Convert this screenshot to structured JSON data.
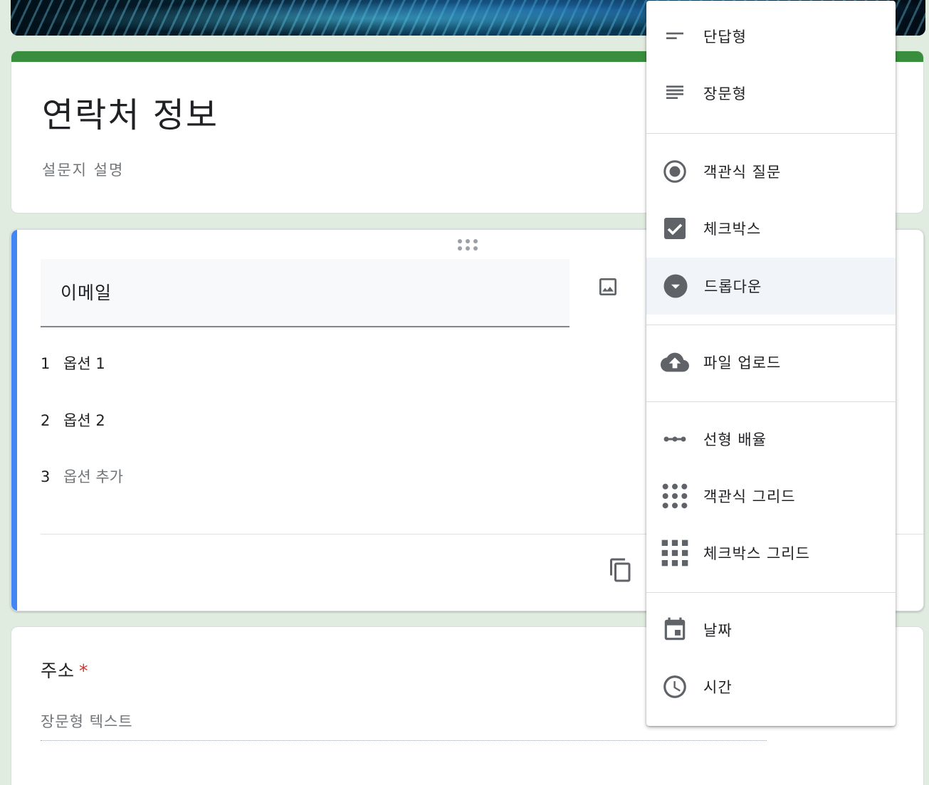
{
  "form": {
    "title": "연락처 정보",
    "description": "설문지 설명"
  },
  "question": {
    "title": "이메일",
    "options": [
      {
        "num": "1",
        "label": "옵션 1"
      },
      {
        "num": "2",
        "label": "옵션 2"
      }
    ],
    "add_option": {
      "num": "3",
      "label": "옵션 추가"
    }
  },
  "address": {
    "title": "주소",
    "required_mark": "*",
    "placeholder": "장문형 텍스트"
  },
  "type_menu": {
    "items": [
      {
        "label": "단답형",
        "icon": "short-answer-icon"
      },
      {
        "label": "장문형",
        "icon": "paragraph-icon"
      },
      {
        "label": "객관식 질문",
        "icon": "radio-button-icon"
      },
      {
        "label": "체크박스",
        "icon": "checkbox-icon"
      },
      {
        "label": "드롭다운",
        "icon": "dropdown-icon",
        "selected": true
      },
      {
        "label": "파일 업로드",
        "icon": "cloud-upload-icon"
      },
      {
        "label": "선형 배율",
        "icon": "linear-scale-icon"
      },
      {
        "label": "객관식 그리드",
        "icon": "dots-grid-icon"
      },
      {
        "label": "체크박스 그리드",
        "icon": "checkbox-grid-icon"
      },
      {
        "label": "날짜",
        "icon": "calendar-icon"
      },
      {
        "label": "시간",
        "icon": "clock-icon"
      }
    ]
  },
  "colors": {
    "background": "#e1ece0",
    "title_bar": "#388e3c",
    "active_bar": "#4285f4",
    "icon": "#5f6368",
    "required": "#d93025"
  }
}
